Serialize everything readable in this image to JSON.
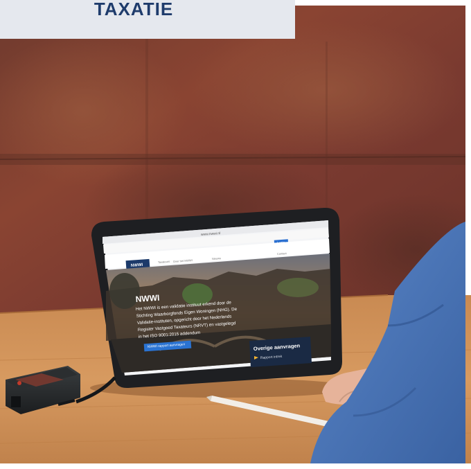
{
  "banner": {
    "title": "TAXATIE"
  },
  "tablet": {
    "url_bar": "www.nwwi.nl",
    "login_label": "Login",
    "site_logo": "NWWI",
    "nav_items": [
      "Taxateurs",
      "Over het NWWI",
      "Nieuws",
      "Contact"
    ],
    "hero": {
      "heading": "NWWI",
      "body_lines": [
        "Het NWWI is een validatie instituut erkend door de",
        "Stichting Waarborgfonds Eigen Woningen (NHG). De",
        "Validatie-instituten, opgericht door het Nederlands",
        "Register Vastgoed Taxateurs (NRVT) en vastgelegd",
        "in het ISO 9001:2015 addendum"
      ],
      "cta_button": "NWWI rapport aanvragen",
      "panel_title": "Overige aanvragen",
      "panel_link": "Rapport intrek"
    }
  },
  "colors": {
    "banner_bg": "#e5e8ee",
    "banner_text": "#1f3c6c",
    "wall": "#7b3a2e",
    "table": "#c58850",
    "sleeve": "#4a74b8"
  },
  "icons": [
    "laser-meter-icon",
    "stylus-icon"
  ]
}
